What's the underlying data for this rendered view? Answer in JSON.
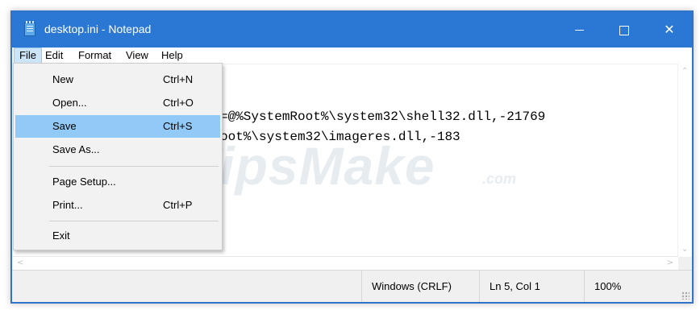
{
  "window": {
    "title": "desktop.ini - Notepad",
    "icon": "notepad-icon",
    "controls": {
      "minimize": "minimize-icon",
      "maximize": "maximize-icon",
      "close": "✕"
    }
  },
  "menubar": {
    "items": [
      {
        "label": "File",
        "active": true
      },
      {
        "label": "Edit"
      },
      {
        "label": "Format"
      },
      {
        "label": "View"
      },
      {
        "label": "Help"
      }
    ]
  },
  "file_menu": {
    "items": [
      {
        "label": "New",
        "shortcut": "Ctrl+N"
      },
      {
        "label": "Open...",
        "shortcut": "Ctrl+O"
      },
      {
        "label": "Save",
        "shortcut": "Ctrl+S",
        "highlighted": true
      },
      {
        "label": "Save As...",
        "shortcut": ""
      },
      {
        "label": "Page Setup...",
        "shortcut": ""
      },
      {
        "label": "Print...",
        "shortcut": "Ctrl+P"
      },
      {
        "label": "Exit",
        "shortcut": ""
      }
    ]
  },
  "editor": {
    "visible_lines": [
      "=@%SystemRoot%\\system32\\shell32.dll,-21769",
      "oot%\\system32\\imageres.dll,-183"
    ]
  },
  "statusbar": {
    "line_ending": "Windows (CRLF)",
    "position": "Ln 5, Col 1",
    "zoom": "100%"
  },
  "watermark": {
    "brand": "TipsMake",
    "suffix": ".com"
  },
  "colors": {
    "titlebar": "#2b78d4",
    "menu_highlight": "#91c9f7",
    "active_menu": "#cce4f7"
  }
}
